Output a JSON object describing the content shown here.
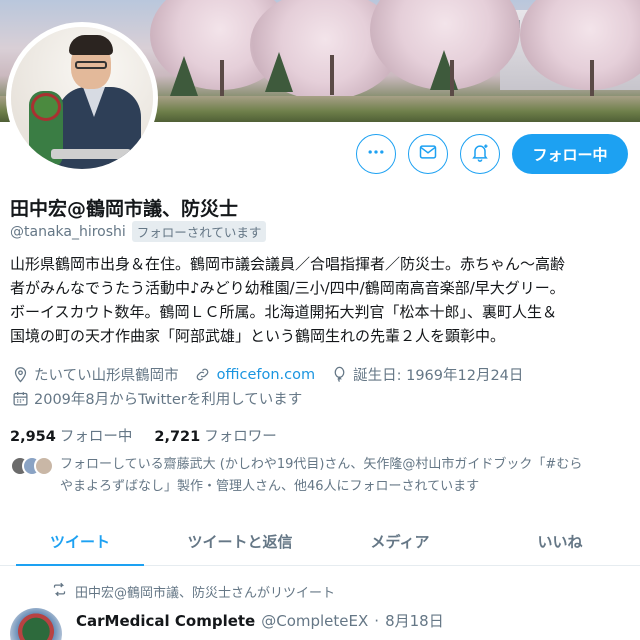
{
  "profile": {
    "name": "田中宏@鶴岡市議、防災士",
    "handle": "@tanaka_hiroshi",
    "follows_you_label": "フォローされています",
    "bio_lines": [
      "山形県鶴岡市出身＆在住。鶴岡市議会議員／合唱指揮者／防災士。赤ちゃん～高齢",
      "者がみんなでうたう活動中♪みどり幼稚園/三小/四中/鶴岡南高音楽部/早大グリー。",
      "ボーイスカウト数年。鶴岡ＬＣ所属。北海道開拓大判官「松本十郎」、裏町人生＆",
      "国境の町の天才作曲家「阿部武雄」という鶴岡生れの先輩２人を顕彰中。"
    ],
    "location": "たいてい山形県鶴岡市",
    "website": "officefon.com",
    "birthday": "誕生日: 1969年12月24日",
    "joined": "2009年8月からTwitterを利用しています",
    "following_count": "2,954",
    "following_label": "フォロー中",
    "followers_count": "2,721",
    "followers_label": "フォロワー",
    "followed_by_lines": [
      "フォローしている齋藤武大 (かしわや19代目)さん、矢作隆@村山市ガイドブック「#むら",
      "やまよろずばなし」製作・管理人さん、他46人にフォローされています"
    ]
  },
  "actions": {
    "more_icon": "more-horizontal-icon",
    "message_icon": "envelope-icon",
    "notify_icon": "bell-plus-icon",
    "follow_button_label": "フォロー中"
  },
  "tabs": [
    {
      "label": "ツイート",
      "active": true
    },
    {
      "label": "ツイートと返信",
      "active": false
    },
    {
      "label": "メディア",
      "active": false
    },
    {
      "label": "いいね",
      "active": false
    }
  ],
  "timeline": {
    "retweet_notice": "田中宏@鶴岡市議、防災士さんがリツイート",
    "tweet": {
      "author_name": "CarMedical Complete",
      "author_handle": "@CompleteEX",
      "separator": "·",
      "date": "8月18日"
    }
  },
  "colors": {
    "accent": "#1da1f2",
    "link": "#1b95e0",
    "secondary_text": "#657786",
    "primary_text": "#14171a"
  }
}
